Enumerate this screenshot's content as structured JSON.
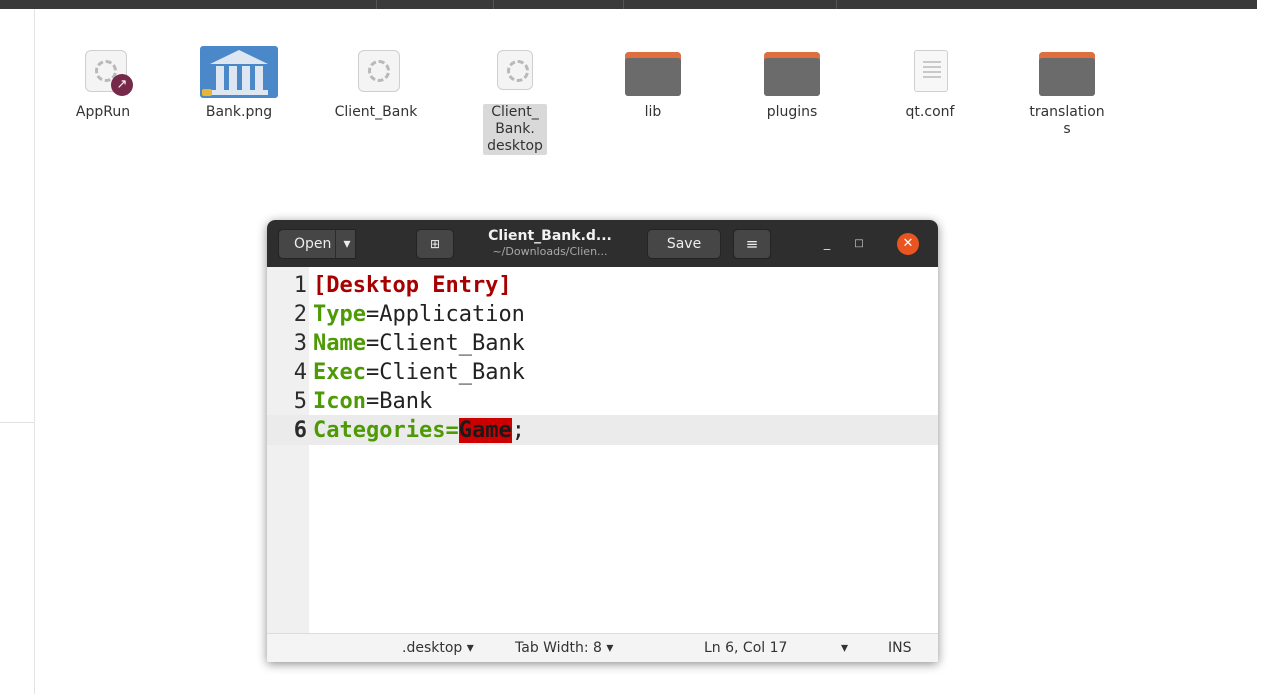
{
  "desktop": {
    "files": [
      {
        "label": "AppRun",
        "icon": "executable-gear-icon"
      },
      {
        "label": "Bank.png",
        "icon": "bank-image-icon"
      },
      {
        "label": "Client_Bank",
        "icon": "executable-gear-icon"
      },
      {
        "label_lines": [
          "Client_",
          "Bank.",
          "desktop"
        ],
        "icon": "desktop-file-gear-icon",
        "selected": true
      },
      {
        "label": "lib",
        "icon": "folder-icon"
      },
      {
        "label": "plugins",
        "icon": "folder-icon"
      },
      {
        "label": "qt.conf",
        "icon": "text-file-icon"
      },
      {
        "label_lines": [
          "translation",
          "s"
        ],
        "icon": "folder-icon"
      }
    ]
  },
  "editor_window": {
    "open_label": "Open",
    "save_label": "Save",
    "title": "Client_Bank.d...",
    "subtitle": "~/Downloads/Clien...",
    "close_color": "#e95420",
    "lines": [
      {
        "num": "1",
        "section": "[Desktop Entry]"
      },
      {
        "num": "2",
        "key": "Type",
        "eq": "=",
        "value": "Application"
      },
      {
        "num": "3",
        "key": "Name",
        "eq": "=",
        "value": "Client_Bank"
      },
      {
        "num": "4",
        "key": "Exec",
        "eq": "=",
        "value": "Client_Bank"
      },
      {
        "num": "5",
        "key": "Icon",
        "eq": "=",
        "value": "Bank"
      },
      {
        "num": "6",
        "key": "Categories",
        "eq": "=",
        "highlight": "Game",
        "rest": ";"
      }
    ],
    "statusbar": {
      "language": ".desktop ▾",
      "tab_width": "Tab Width: 8 ▾",
      "position": "Ln 6, Col 17",
      "dropdown": "▾",
      "mode": "INS"
    }
  }
}
